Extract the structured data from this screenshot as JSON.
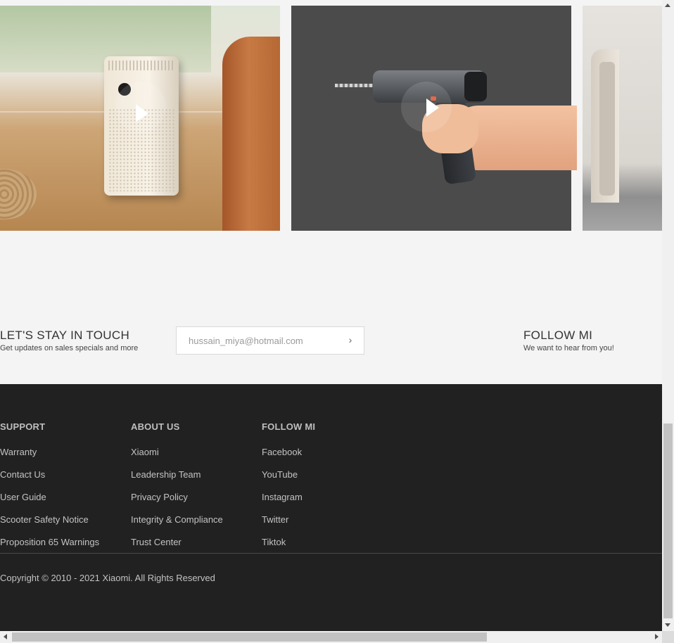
{
  "videos": [
    {
      "subject": "air purifier",
      "play_icon": "play-icon"
    },
    {
      "subject": "cordless drill",
      "play_icon": "play-icon"
    },
    {
      "subject": "furniture",
      "play_icon": ""
    }
  ],
  "newsletter": {
    "title": "LET'S STAY IN TOUCH",
    "subtitle": "Get updates on sales specials and more",
    "email_placeholder": "hussain_miya@hotmail.com",
    "submit_icon": "chevron-right-icon",
    "submit_glyph": "›"
  },
  "follow": {
    "title": "FOLLOW MI",
    "subtitle": "We want to hear from you!"
  },
  "footer": {
    "columns": [
      {
        "heading": "SUPPORT",
        "links": [
          "Warranty",
          "Contact Us",
          "User Guide",
          "Scooter Safety Notice",
          "Proposition 65 Warnings"
        ]
      },
      {
        "heading": "ABOUT US",
        "links": [
          "Xiaomi",
          "Leadership Team",
          "Privacy Policy",
          "Integrity & Compliance",
          "Trust Center"
        ]
      },
      {
        "heading": "FOLLOW MI",
        "links": [
          "Facebook",
          "YouTube",
          "Instagram",
          "Twitter",
          "Tiktok"
        ]
      }
    ],
    "copyright": "Copyright © 2010 - 2021 Xiaomi. All Rights Reserved"
  },
  "colors": {
    "page_background": "#f4f4f4",
    "footer_background": "#212122",
    "footer_text": "#c3c3c3"
  }
}
